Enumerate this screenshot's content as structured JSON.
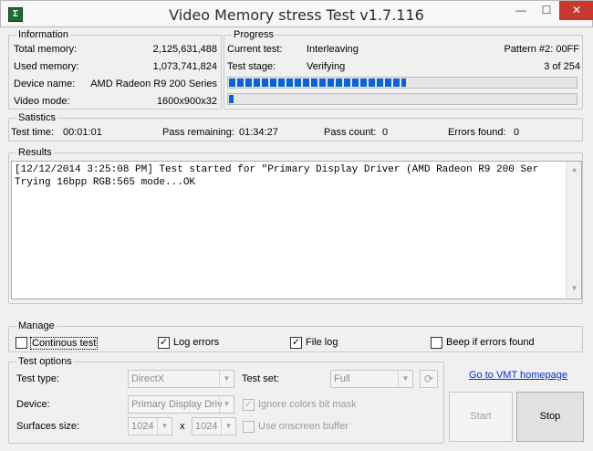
{
  "window": {
    "title": "Video Memory stress Test v1.7.116",
    "icon_text": "Ʃ",
    "minimize": "—",
    "maximize": "☐",
    "close": "✕"
  },
  "information": {
    "legend": "Information",
    "total_memory_label": "Total memory:",
    "total_memory_value": "2,125,631,488",
    "used_memory_label": "Used memory:",
    "used_memory_value": "1,073,741,824",
    "device_name_label": "Device name:",
    "device_name_value": "AMD Radeon R9 200 Series",
    "video_mode_label": "Video mode:",
    "video_mode_value": "1600x900x32"
  },
  "progress": {
    "legend": "Progress",
    "current_test_label": "Current test:",
    "current_test_value": "Interleaving",
    "pattern_value": "Pattern #2: 00FF",
    "test_stage_label": "Test stage:",
    "test_stage_value": "Verifying",
    "stage_count": "3 of 254",
    "bar1_fraction": 0.51,
    "bar2_fraction": 0.01
  },
  "statistics": {
    "legend": "Satistics",
    "test_time_label": "Test time:",
    "test_time_value": "00:01:01",
    "pass_remaining_label": "Pass remaining:",
    "pass_remaining_value": "01:34:27",
    "pass_count_label": "Pass count:",
    "pass_count_value": "0",
    "errors_found_label": "Errors found:",
    "errors_found_value": "0"
  },
  "results": {
    "legend": "Results",
    "lines": [
      "[12/12/2014 3:25:08 PM] Test started for \"Primary Display Driver (AMD Radeon R9 200 Ser",
      "Trying 16bpp RGB:565 mode...OK"
    ]
  },
  "manage": {
    "legend": "Manage",
    "continuous_test_label": "Continous test",
    "continuous_test_checked": false,
    "log_errors_label": "Log errors",
    "log_errors_checked": true,
    "file_log_label": "File log",
    "file_log_checked": true,
    "beep_label": "Beep if errors found",
    "beep_checked": false
  },
  "test_options": {
    "legend": "Test options",
    "test_type_label": "Test type:",
    "test_type_value": "DirectX",
    "test_set_label": "Test set:",
    "test_set_value": "Full",
    "device_label": "Device:",
    "device_value": "Primary Display Driv",
    "ignore_colors_label": "Ignore colors bit mask",
    "ignore_colors_checked": true,
    "surfaces_label": "Surfaces size:",
    "surface_width": "1024",
    "surface_x": "x",
    "surface_height": "1024",
    "use_onscreen_label": "Use onscreen buffer",
    "use_onscreen_checked": false
  },
  "actions": {
    "homepage_link": "Go to VMT homepage",
    "start_label": "Start",
    "stop_label": "Stop"
  },
  "icons": {
    "check": "✓",
    "dropdown": "▼",
    "scroll_up": "▲",
    "scroll_down": "▼",
    "refresh": "⟳"
  },
  "colors": {
    "progress_fill": "#0a64d6",
    "link": "#0033cc",
    "close_button": "#c8372e"
  }
}
